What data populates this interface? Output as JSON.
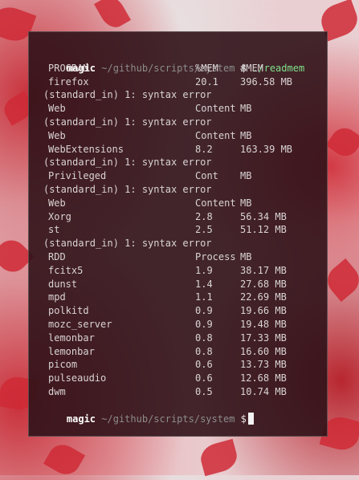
{
  "theme": {
    "prompt_user": "#ffffff",
    "prompt_path": "#8c8c8c",
    "command": "#7ee08a",
    "text": "#d9d4d4"
  },
  "prompt": {
    "user": "magic",
    "path": "~/github/scripts/system",
    "symbol": "$"
  },
  "command": "./readmem",
  "output": [
    {
      "type": "row",
      "cols": [
        "PROGRAM",
        "%MEM",
        "#MEM"
      ]
    },
    {
      "type": "row",
      "cols": [
        "firefox",
        "20.1",
        "396.58 MB"
      ]
    },
    {
      "type": "text",
      "text": "(standard_in) 1: syntax error"
    },
    {
      "type": "row",
      "cols": [
        "Web",
        "Content",
        "MB"
      ]
    },
    {
      "type": "text",
      "text": "(standard_in) 1: syntax error"
    },
    {
      "type": "row",
      "cols": [
        "Web",
        "Content",
        "MB"
      ]
    },
    {
      "type": "row",
      "cols": [
        "WebExtensions",
        "8.2",
        "163.39 MB"
      ]
    },
    {
      "type": "text",
      "text": "(standard_in) 1: syntax error"
    },
    {
      "type": "row",
      "cols": [
        "Privileged",
        "Cont",
        "MB"
      ]
    },
    {
      "type": "text",
      "text": "(standard_in) 1: syntax error"
    },
    {
      "type": "row",
      "cols": [
        "Web",
        "Content",
        "MB"
      ]
    },
    {
      "type": "row",
      "cols": [
        "Xorg",
        "2.8",
        "56.34 MB"
      ]
    },
    {
      "type": "row",
      "cols": [
        "st",
        "2.5",
        "51.12 MB"
      ]
    },
    {
      "type": "text",
      "text": "(standard_in) 1: syntax error"
    },
    {
      "type": "row",
      "cols": [
        "RDD",
        "Process",
        "MB"
      ]
    },
    {
      "type": "row",
      "cols": [
        "fcitx5",
        "1.9",
        "38.17 MB"
      ]
    },
    {
      "type": "row",
      "cols": [
        "dunst",
        "1.4",
        "27.68 MB"
      ]
    },
    {
      "type": "row",
      "cols": [
        "mpd",
        "1.1",
        "22.69 MB"
      ]
    },
    {
      "type": "row",
      "cols": [
        "polkitd",
        "0.9",
        "19.66 MB"
      ]
    },
    {
      "type": "row",
      "cols": [
        "mozc_server",
        "0.9",
        "19.48 MB"
      ]
    },
    {
      "type": "row",
      "cols": [
        "lemonbar",
        "0.8",
        "17.33 MB"
      ]
    },
    {
      "type": "row",
      "cols": [
        "lemonbar",
        "0.8",
        "16.60 MB"
      ]
    },
    {
      "type": "row",
      "cols": [
        "picom",
        "0.6",
        "13.73 MB"
      ]
    },
    {
      "type": "row",
      "cols": [
        "pulseaudio",
        "0.6",
        "12.68 MB"
      ]
    },
    {
      "type": "row",
      "cols": [
        "dwm",
        "0.5",
        "10.74 MB"
      ]
    }
  ]
}
